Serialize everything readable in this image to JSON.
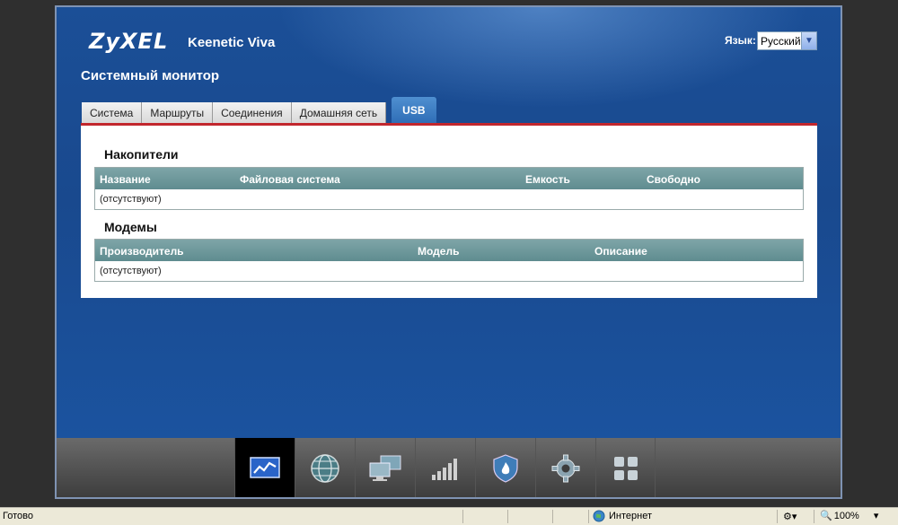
{
  "header": {
    "logo": "ZyXEL",
    "model": "Keenetic Viva",
    "language_label": "Язык:",
    "language_value": "Русский"
  },
  "page_title": "Системный монитор",
  "tabs": [
    {
      "label": "Система"
    },
    {
      "label": "Маршруты"
    },
    {
      "label": "Соединения"
    },
    {
      "label": "Домашняя сеть"
    },
    {
      "label": "USB",
      "active": true
    }
  ],
  "storage": {
    "title": "Накопители",
    "columns": [
      "Название",
      "Файловая система",
      "Емкость",
      "Свободно"
    ],
    "empty_text": "(отсутствуют)"
  },
  "modems": {
    "title": "Модемы",
    "columns": [
      "Производитель",
      "Модель",
      "Описание"
    ],
    "empty_text": "(отсутствуют)"
  },
  "dock": {
    "items": [
      {
        "icon": "monitor-chart-icon",
        "active": true
      },
      {
        "icon": "globe-icon"
      },
      {
        "icon": "computers-icon"
      },
      {
        "icon": "signal-bars-icon"
      },
      {
        "icon": "shield-fire-icon"
      },
      {
        "icon": "gear-icon"
      },
      {
        "icon": "apps-grid-icon"
      }
    ]
  },
  "statusbar": {
    "ready": "Готово",
    "zone": "Интернет",
    "zoom": "100%"
  },
  "colors": {
    "background": "#1a4f96",
    "accent_line": "#c2272d",
    "table_header": "#6f989b",
    "active_tab": "#3b7cc3"
  }
}
